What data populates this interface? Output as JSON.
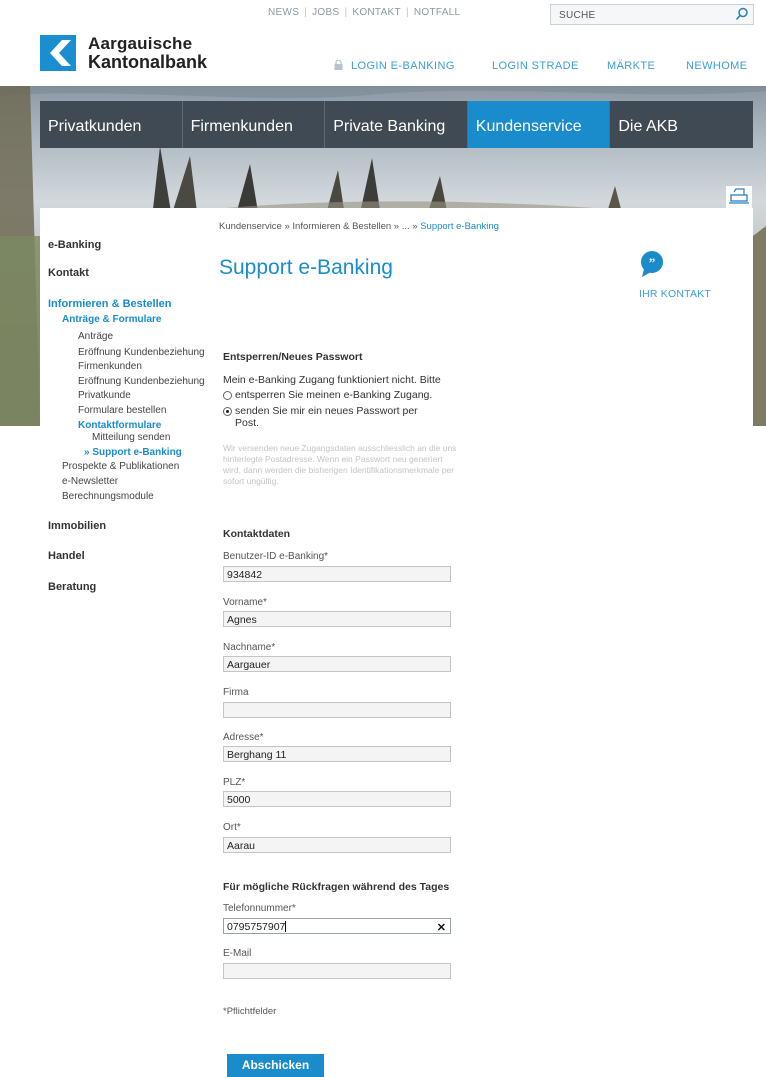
{
  "util_nav": [
    "NEWS",
    "JOBS",
    "KONTAKT",
    "NOTFALL"
  ],
  "search": {
    "placeholder": "SUCHE"
  },
  "logo": {
    "line1": "Aargauische",
    "line2": "Kantonalbank"
  },
  "service_nav": [
    "LOGIN E-BANKING",
    "LOGIN STRADE",
    "MÄRKTE",
    "NEWHOME"
  ],
  "main_nav": [
    "Privatkunden",
    "Firmenkunden",
    "Private Banking",
    "Kundenservice",
    "Die AKB"
  ],
  "main_nav_active": "Kundenservice",
  "colors": {
    "accent": "#1a8ccb",
    "nav": "#3f4a54"
  },
  "sidebar": {
    "ebanking": "e-Banking",
    "kontakt": "Kontakt",
    "informieren": "Informieren & Bestellen",
    "antraege_formulare": "Anträge & Formulare",
    "items": [
      "Anträge",
      "Eröffnung Kundenbeziehung",
      "Firmenkunden",
      "Eröffnung Kundenbeziehung",
      "Privatkunde",
      "Formulare bestellen"
    ],
    "kontaktformulare": "Kontaktformulare",
    "mitteilung": "Mitteilung senden",
    "support": "» Support e-Banking",
    "prospekte": "Prospekte & Publikationen",
    "newsletter": "e-Newsletter",
    "berechnung": "Berechnungsmodule",
    "immobilien": "Immobilien",
    "handel": "Handel",
    "beratung": "Beratung"
  },
  "breadcrumb": {
    "path": "Kundenservice » Informieren & Bestellen » ... » ",
    "current": "Support e-Banking"
  },
  "page_title": "Support e-Banking",
  "contact": {
    "label": "IHR KONTAKT"
  },
  "unlock": {
    "heading": "Entsperren/Neues Passwort",
    "intro": "Mein e-Banking Zugang funktioniert nicht. Bitte",
    "option1": "entsperren Sie meinen e-Banking Zugang.",
    "option2": "senden Sie mir ein neues Passwort per Post.",
    "note": "Wir versenden neue Zugangsdaten ausschliesslich an die uns hinterlegte Postadresse. Wenn ein Passwort neu generiert wird, dann werden die bisherigen Identifikationsmerkmale per sofort ungültig."
  },
  "kontaktdaten": {
    "heading": "Kontaktdaten",
    "fields": [
      {
        "label": "Benutzer-ID e-Banking*",
        "value": "934842"
      },
      {
        "label": "Vorname*",
        "value": "Agnes"
      },
      {
        "label": "Nachname*",
        "value": "Aargauer"
      },
      {
        "label": "Firma",
        "value": ""
      },
      {
        "label": "Adresse*",
        "value": "Berghang 11"
      },
      {
        "label": "PLZ*",
        "value": "5000"
      },
      {
        "label": "Ort*",
        "value": "Aarau"
      }
    ]
  },
  "rueckfragen": {
    "heading": "Für mögliche Rückfragen während des Tages",
    "phone_label": "Telefonnummer*",
    "phone_value": "0795757907",
    "email_label": "E-Mail",
    "email_value": ""
  },
  "required_note": "*Pflichtfelder",
  "submit_label": "Abschicken"
}
